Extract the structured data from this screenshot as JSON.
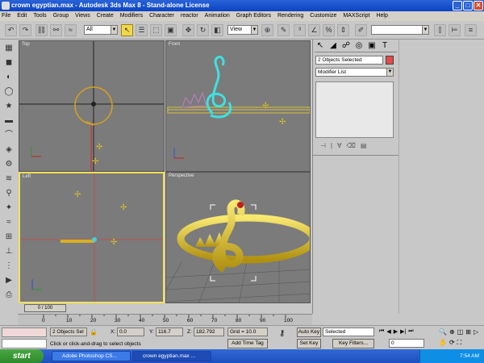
{
  "window": {
    "title": "crown egyptian.max - Autodesk 3ds Max 8 - Stand-alone License",
    "min": "_",
    "max": "□",
    "close": "✕"
  },
  "menu": [
    "File",
    "Edit",
    "Tools",
    "Group",
    "Views",
    "Create",
    "Modifiers",
    "Character",
    "reactor",
    "Animation",
    "Graph Editors",
    "Rendering",
    "Customize",
    "MAXScript",
    "Help"
  ],
  "toolbar": {
    "selection_filter": "All",
    "reference_coord": "View",
    "named_selection": ""
  },
  "viewports": {
    "top": "Top",
    "front": "Front",
    "left": "Left",
    "perspective": "Perspective"
  },
  "command_panel": {
    "selection_name": "2 Objects Selected",
    "selection_color": "#e24a4a",
    "modifier_list": "Modifier List"
  },
  "timeline": {
    "slider": "0 / 100",
    "ticks": [
      "0",
      "10",
      "20",
      "30",
      "40",
      "50",
      "60",
      "70",
      "80",
      "90",
      "100"
    ]
  },
  "status": {
    "selected": "2 Objects Sel",
    "x_label": "X:",
    "x_value": "0.0",
    "y_label": "Y:",
    "y_value": "116.7",
    "z_label": "Z:",
    "z_value": "182.792",
    "grid": "Grid = 10.0",
    "prompt": "Click or click-and-drag to select objects",
    "add_time_tag": "Add Time Tag",
    "auto_key": "Auto Key",
    "set_key": "Set Key",
    "key_mode": "Selected",
    "key_filters": "Key Filters...",
    "frame": "0"
  },
  "taskbar": {
    "start": "start",
    "tasks": [
      "Adobe Photoshop CS...",
      "crown egyptian.max ..."
    ],
    "clock": "7:54 AM"
  },
  "colors": {
    "active_viewport": "#f3e058",
    "viewport_bg": "#7b7b7b",
    "wireframe_selected": "#ffffff",
    "crown_gold": "#d8c03a"
  }
}
